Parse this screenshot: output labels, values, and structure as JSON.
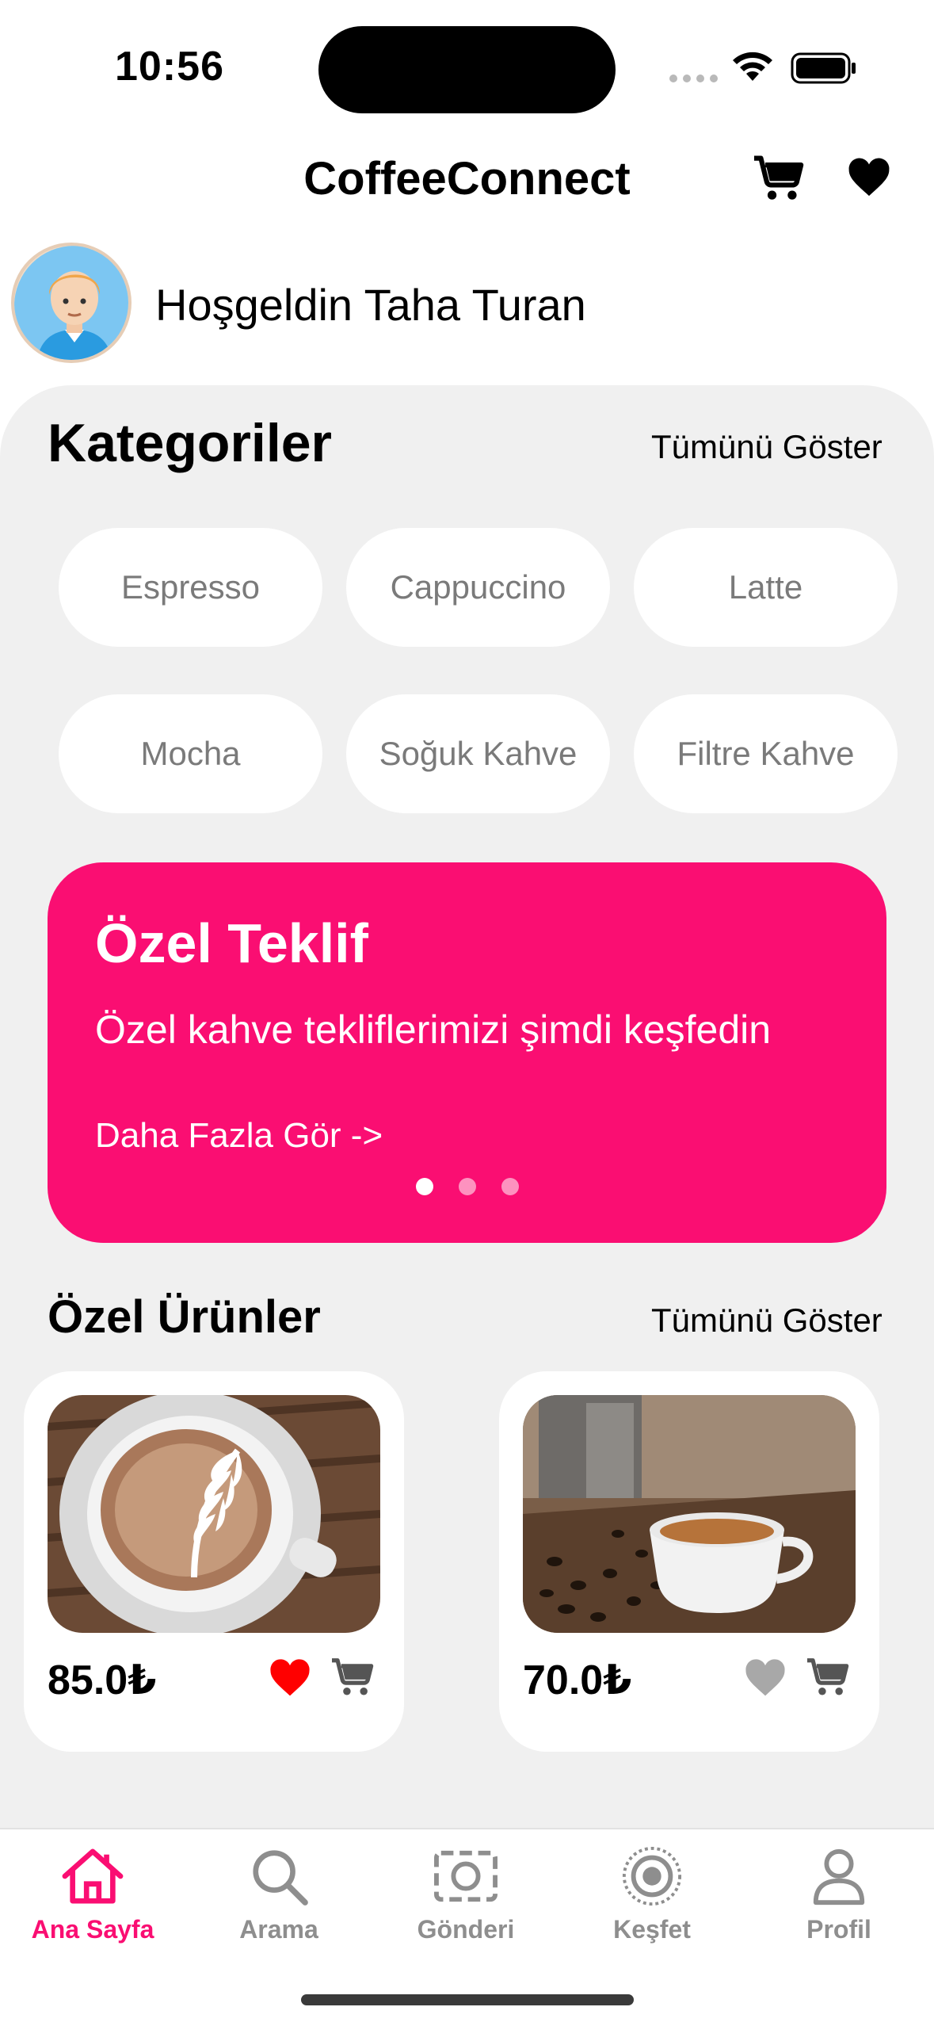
{
  "status": {
    "time": "10:56"
  },
  "header": {
    "title": "CoffeeConnect"
  },
  "greeting": "Hoşgeldin Taha Turan",
  "categories": {
    "title": "Kategoriler",
    "show_all": "Tümünü Göster",
    "items": [
      "Espresso",
      "Cappuccino",
      "Latte",
      "Mocha",
      "Soğuk Kahve",
      "Filtre Kahve"
    ]
  },
  "offer": {
    "title": "Özel Teklif",
    "subtitle": "Özel kahve tekliflerimizi şimdi keşfedin",
    "link": "Daha Fazla Gör ->",
    "page_count": 3,
    "active_page": 0
  },
  "featured": {
    "title": "Özel Ürünler",
    "show_all": "Tümünü Göster",
    "products": [
      {
        "price": "85.0₺",
        "favorite": true
      },
      {
        "price": "70.0₺",
        "favorite": false
      }
    ]
  },
  "tabs": [
    {
      "label": "Ana Sayfa",
      "icon": "home-icon",
      "active": true
    },
    {
      "label": "Arama",
      "icon": "search-icon",
      "active": false
    },
    {
      "label": "Gönderi",
      "icon": "camera-frame-icon",
      "active": false
    },
    {
      "label": "Keşfet",
      "icon": "explore-icon",
      "active": false
    },
    {
      "label": "Profil",
      "icon": "person-icon",
      "active": false
    }
  ],
  "colors": {
    "accent": "#fa0e72",
    "sheet": "#f0f0f0",
    "favorite_on": "#ff0000",
    "favorite_off": "#a8a8a8"
  }
}
